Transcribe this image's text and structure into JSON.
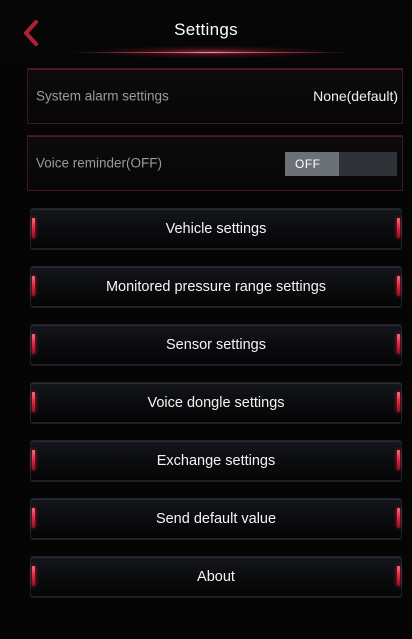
{
  "header": {
    "title": "Settings"
  },
  "alarm": {
    "label": "System alarm settings",
    "value": "None(default)"
  },
  "voice": {
    "label": "Voice reminder(OFF)",
    "toggle_label": "OFF"
  },
  "menu": {
    "items": [
      {
        "label": "Vehicle settings"
      },
      {
        "label": "Monitored pressure range settings"
      },
      {
        "label": "Sensor settings"
      },
      {
        "label": "Voice dongle settings"
      },
      {
        "label": "Exchange settings"
      },
      {
        "label": "Send default value"
      },
      {
        "label": "About"
      }
    ]
  },
  "colors": {
    "accent": "#e2233f",
    "background": "#050506",
    "toggle_track": "#2f3338",
    "toggle_knob": "#6c7178"
  },
  "icons": {
    "back": "chevron-left-icon"
  }
}
